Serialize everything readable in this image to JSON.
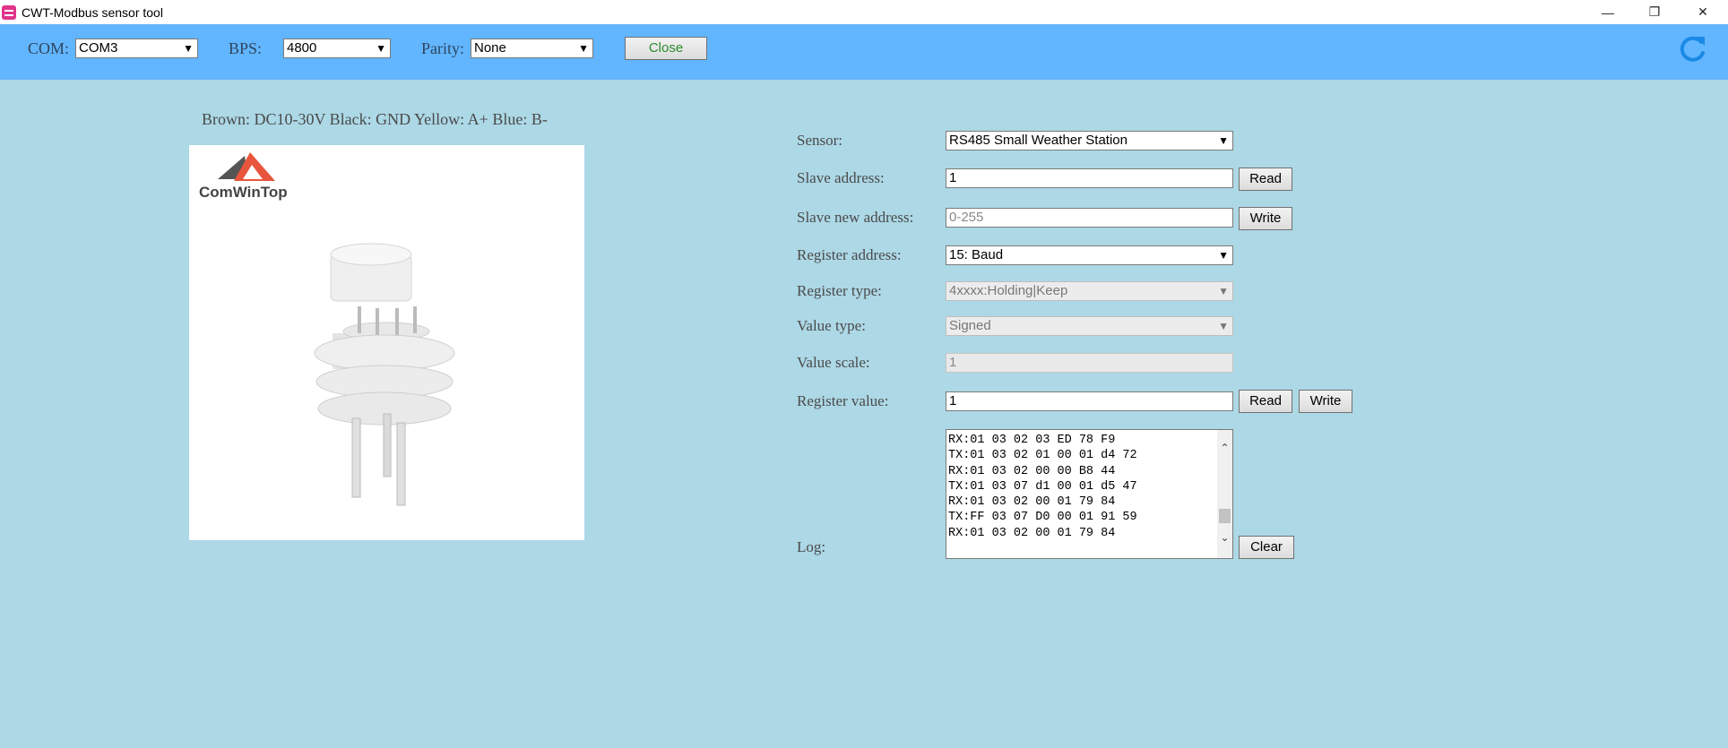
{
  "window": {
    "title": "CWT-Modbus sensor tool",
    "minimize": "—",
    "restore": "❐",
    "close": "✕"
  },
  "toolbar": {
    "com_label": "COM:",
    "com_value": "COM3",
    "bps_label": "BPS:",
    "bps_value": "4800",
    "parity_label": "Parity:",
    "parity_value": "None",
    "close_button": "Close"
  },
  "wiring": "Brown: DC10-30V  Black: GND  Yellow: A+  Blue: B-",
  "product": {
    "brand": "ComWinTop"
  },
  "form": {
    "sensor_label": "Sensor:",
    "sensor_value": "RS485 Small Weather Station",
    "slave_label": "Slave address:",
    "slave_value": "1",
    "read_button": "Read",
    "new_addr_label": "Slave new address:",
    "new_addr_placeholder": "0-255",
    "write_button": "Write",
    "reg_addr_label": "Register address:",
    "reg_addr_value": "15: Baud",
    "reg_type_label": "Register type:",
    "reg_type_value": "4xxxx:Holding|Keep",
    "value_type_label": "Value type:",
    "value_type_value": "Signed",
    "value_scale_label": "Value scale:",
    "value_scale_value": "1",
    "reg_value_label": "Register value:",
    "reg_value_value": "1",
    "reg_read_button": "Read",
    "reg_write_button": "Write",
    "log_label": "Log:",
    "clear_button": "Clear"
  },
  "log_lines": [
    "RX:01 03 02 03 ED 78 F9",
    "TX:01 03 02 01 00 01 d4 72",
    "RX:01 03 02 00 00 B8 44",
    "TX:01 03 07 d1 00 01 d5 47",
    "RX:01 03 02 00 01 79 84",
    "TX:FF 03 07 D0 00 01 91 59",
    "RX:01 03 02 00 01 79 84"
  ],
  "icons": {
    "refresh": "refresh-icon",
    "dropdown": "chevron-down-icon"
  },
  "colors": {
    "toolbar": "#62b5ff",
    "background": "#add8e6",
    "accent": "#1a8ae6"
  }
}
